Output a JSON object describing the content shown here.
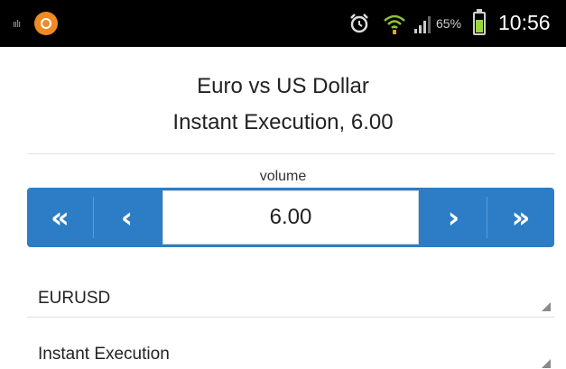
{
  "status_bar": {
    "data_icon": "data-icon",
    "app_icon": "app-notification-icon",
    "alarm_icon": "alarm-icon",
    "wifi_icon": "wifi-icon",
    "signal_icon": "signal-icon",
    "battery_percent": "65%",
    "battery_level": 0.65,
    "time": "10:56",
    "data_text": "ıılı"
  },
  "header": {
    "symbol_title": "Euro vs US Dollar",
    "subtitle": "Instant Execution, 6.00"
  },
  "volume": {
    "label": "volume",
    "value": "6.00",
    "buttons": {
      "decrease_fast": "«",
      "decrease": "‹",
      "increase": "›",
      "increase_fast": "»"
    },
    "accent_color": "#2d7dc6"
  },
  "symbol_select": {
    "value": "EURUSD"
  },
  "execution_select": {
    "value": "Instant Execution"
  }
}
